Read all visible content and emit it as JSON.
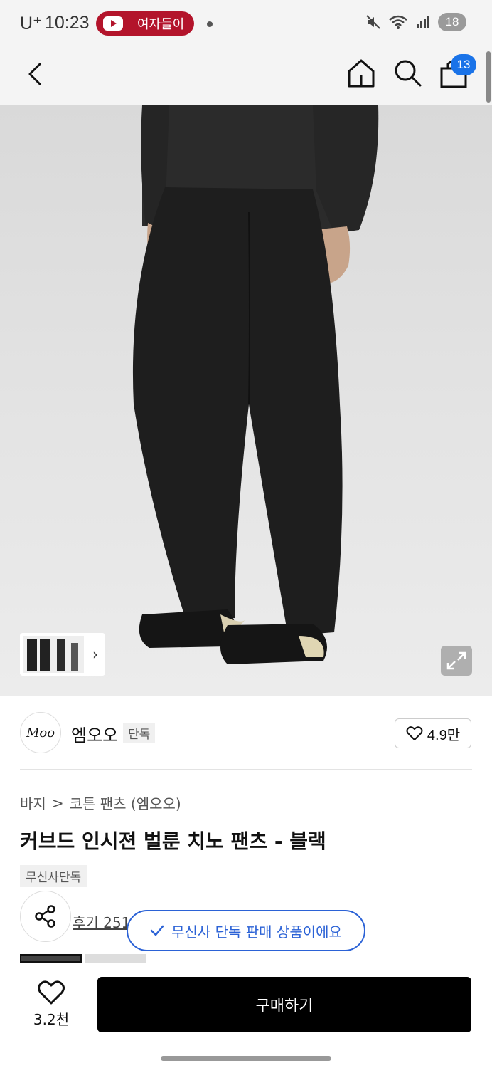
{
  "status_bar": {
    "carrier": "U⁺",
    "time": "10:23",
    "app_pill_text": "여자들이",
    "battery": "18"
  },
  "header": {
    "cart_count": "13",
    "icons": [
      "back-icon",
      "home-icon",
      "search-icon",
      "cart-icon"
    ]
  },
  "brand": {
    "logo_text": "Moo",
    "name": "엠오오",
    "tag": "단독",
    "likes": "4.9만"
  },
  "breadcrumb": {
    "category": "바지",
    "separator": ">",
    "subcategory": "코튼 팬츠 (엠오오)"
  },
  "product": {
    "title": "커브드 인시젼 벌룬 치노 팬츠 - 블랙",
    "exclusive_tag": "무신사단독",
    "review_text": "후기 251"
  },
  "toast": {
    "text": "무신사 단독 판매 상품이에요"
  },
  "bottom_bar": {
    "wish_count": "3.2천",
    "buy_label": "구매하기"
  },
  "colors": {
    "brand_blue": "#2b62d6",
    "badge_blue": "#1a73e8",
    "yt_red": "#b3142b",
    "buy_black": "#000000"
  }
}
